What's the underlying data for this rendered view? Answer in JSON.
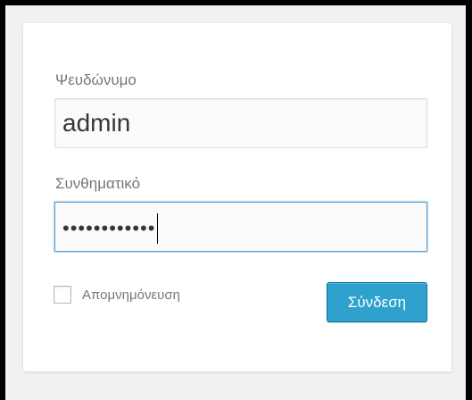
{
  "form": {
    "username_label": "Ψευδώνυμο",
    "username_value": "admin",
    "password_label": "Συνθηματικό",
    "password_masked": "••••••••••••",
    "remember_label": "Απομνημόνευση",
    "remember_checked": false,
    "submit_label": "Σύνδεση"
  },
  "colors": {
    "accent": "#2ea2cc",
    "focus_border": "#5b9dd9",
    "background": "#f1f1f1"
  }
}
